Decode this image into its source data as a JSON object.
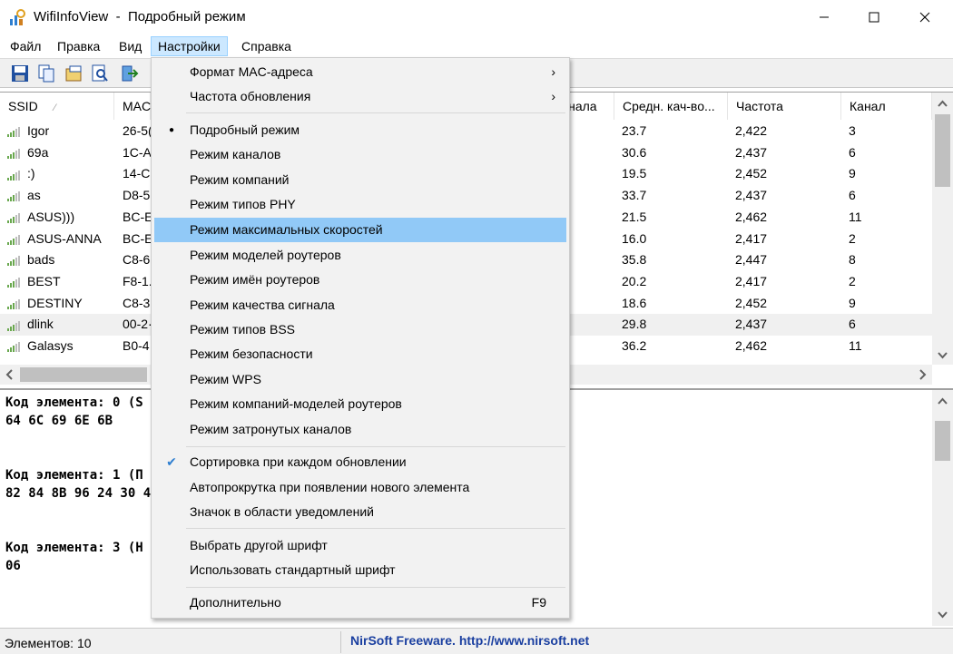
{
  "window": {
    "app_name": "WifiInfoView",
    "title_sep": "-",
    "mode_title": "Подробный режим"
  },
  "menubar": [
    "Файл",
    "Правка",
    "Вид",
    "Настройки",
    "Справка"
  ],
  "columns": [
    "SSID",
    "MAC",
    "гнала",
    "Средн. кач-во...",
    "Частота",
    "Канал"
  ],
  "rows": [
    {
      "ssid": "Igor",
      "mac": "26-5(",
      "quality": "23.7",
      "freq": "2,422",
      "channel": "3"
    },
    {
      "ssid": "69a",
      "mac": "1C-A",
      "quality": "30.6",
      "freq": "2,437",
      "channel": "6"
    },
    {
      "ssid": ":)",
      "mac": "14-C",
      "quality": "19.5",
      "freq": "2,452",
      "channel": "9"
    },
    {
      "ssid": "as",
      "mac": "D8-5",
      "quality": "33.7",
      "freq": "2,437",
      "channel": "6"
    },
    {
      "ssid": "ASUS)))",
      "mac": "BC-E",
      "quality": "21.5",
      "freq": "2,462",
      "channel": "11"
    },
    {
      "ssid": "ASUS-ANNA",
      "mac": "BC-E",
      "quality": "16.0",
      "freq": "2,417",
      "channel": "2"
    },
    {
      "ssid": "bads",
      "mac": "C8-6",
      "quality": "35.8",
      "freq": "2,447",
      "channel": "8"
    },
    {
      "ssid": "BEST",
      "mac": "F8-1.",
      "quality": "20.2",
      "freq": "2,417",
      "channel": "2"
    },
    {
      "ssid": "DESTINY",
      "mac": "C8-3",
      "quality": "18.6",
      "freq": "2,452",
      "channel": "9"
    },
    {
      "ssid": "dlink",
      "mac": "00-2·",
      "quality": "29.8",
      "freq": "2,437",
      "channel": "6"
    },
    {
      "ssid": "Galasys",
      "mac": "B0-4",
      "quality": "36.2",
      "freq": "2,462",
      "channel": "11"
    }
  ],
  "details": [
    "Код элемента: 0  (S",
    "64 6C 69 6E 6B",
    "Код элемента: 1  (П",
    "82 84 8B 96 24 30 4",
    "Код элемента: 3  (Н",
    "06"
  ],
  "status": {
    "count": "Элементов: 10",
    "credit": "NirSoft Freeware.  http://www.nirsoft.net"
  },
  "dropdown": {
    "items": [
      {
        "label": "Формат MAC-адреса",
        "submenu": "›"
      },
      {
        "label": "Частота обновления",
        "submenu": "›"
      },
      {
        "label": "Подробный режим",
        "mark": "●"
      },
      {
        "label": "Режим каналов"
      },
      {
        "label": "Режим компаний"
      },
      {
        "label": "Режим типов PHY"
      },
      {
        "label": "Режим максимальных скоростей"
      },
      {
        "label": "Режим моделей роутеров"
      },
      {
        "label": "Режим имён роутеров"
      },
      {
        "label": "Режим качества сигнала"
      },
      {
        "label": "Режим типов BSS"
      },
      {
        "label": "Режим безопасности"
      },
      {
        "label": "Режим WPS"
      },
      {
        "label": "Режим компаний-моделей роутеров"
      },
      {
        "label": "Режим затронутых каналов"
      },
      {
        "label": "Сортировка при каждом обновлении",
        "mark": "✔"
      },
      {
        "label": "Автопрокрутка при появлении нового элемента"
      },
      {
        "label": "Значок в области уведомлений"
      },
      {
        "label": "Выбрать другой шрифт"
      },
      {
        "label": "Использовать стандартный шрифт"
      },
      {
        "label": "Дополнительно",
        "shortcut": "F9"
      }
    ]
  },
  "colors": {
    "menu_hover": "#91c9f7",
    "menu_active": "#cce8ff",
    "signal_green": "#6aa84f",
    "link_blue": "#1a3fa0"
  }
}
